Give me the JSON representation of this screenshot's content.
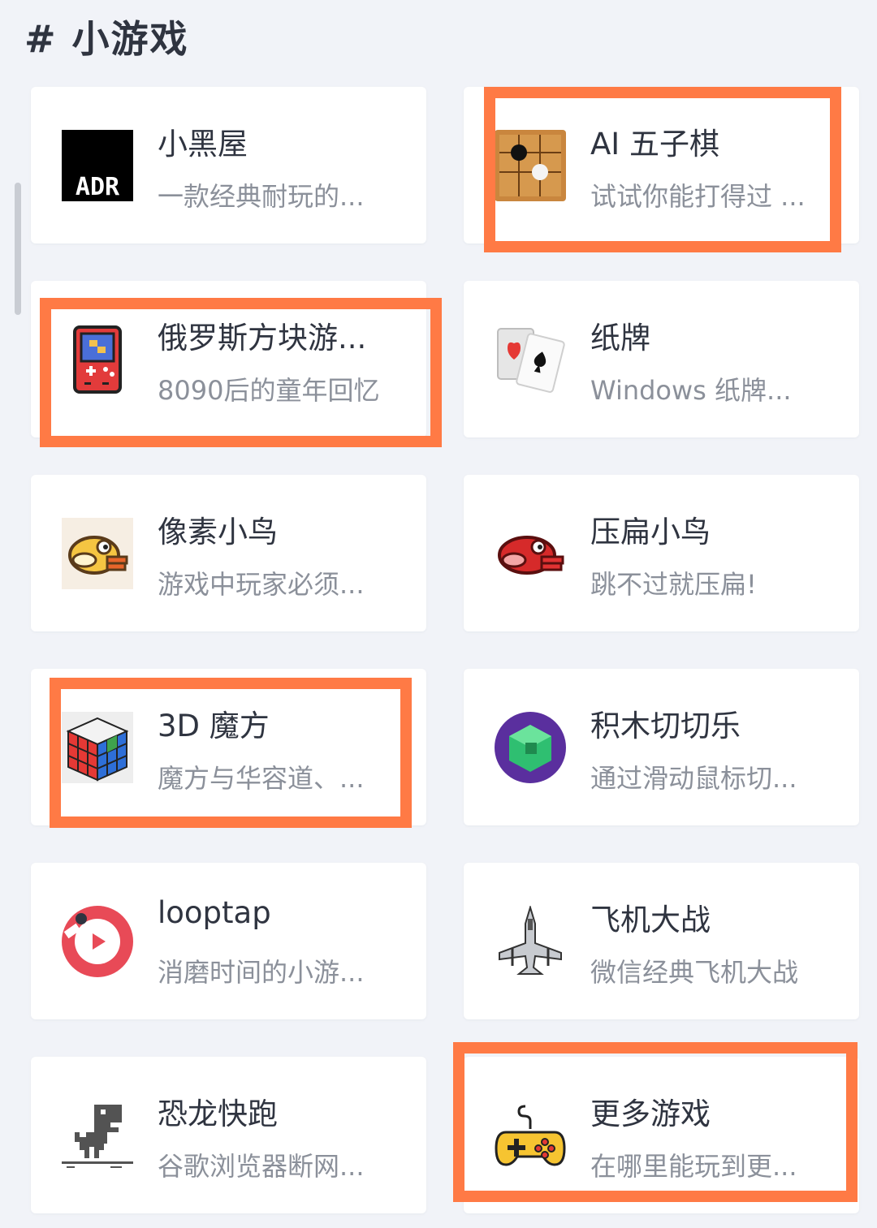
{
  "section": {
    "hash": "#",
    "title": "小游戏"
  },
  "colors": {
    "background": "#f1f3f8",
    "card": "#ffffff",
    "highlight": "#ff7a45",
    "title": "#2f3440",
    "desc": "#8b909a"
  },
  "games": [
    {
      "title": "小黑屋",
      "desc": "一款经典耐玩的...",
      "icon": "adr-logo-icon",
      "icon_text": "ADR",
      "highlighted": false
    },
    {
      "title": "AI 五子棋",
      "desc": "试试你能打得过 ...",
      "icon": "gomoku-board-icon",
      "highlighted": true
    },
    {
      "title": "俄罗斯方块游...",
      "desc": "8090后的童年回忆",
      "icon": "tetris-console-icon",
      "highlighted": true
    },
    {
      "title": "纸牌",
      "desc": "Windows 纸牌...",
      "icon": "playing-cards-icon",
      "highlighted": false
    },
    {
      "title": "像素小鸟",
      "desc": "游戏中玩家必须...",
      "icon": "pixel-bird-icon",
      "highlighted": false
    },
    {
      "title": "压扁小鸟",
      "desc": "跳不过就压扁!",
      "icon": "red-pixel-bird-icon",
      "highlighted": false
    },
    {
      "title": "3D 魔方",
      "desc": "魔方与华容道、...",
      "icon": "rubiks-cube-icon",
      "highlighted": true
    },
    {
      "title": "积木切切乐",
      "desc": "通过滑动鼠标切...",
      "icon": "block-slice-icon",
      "highlighted": false
    },
    {
      "title": "looptap",
      "desc": "消磨时间的小游...",
      "icon": "looptap-icon",
      "highlighted": false
    },
    {
      "title": "飞机大战",
      "desc": "微信经典飞机大战",
      "icon": "fighter-plane-icon",
      "highlighted": false
    },
    {
      "title": "恐龙快跑",
      "desc": "谷歌浏览器断网...",
      "icon": "dinosaur-icon",
      "highlighted": false
    },
    {
      "title": "更多游戏",
      "desc": "在哪里能玩到更...",
      "icon": "gamepad-icon",
      "highlighted": true
    }
  ]
}
